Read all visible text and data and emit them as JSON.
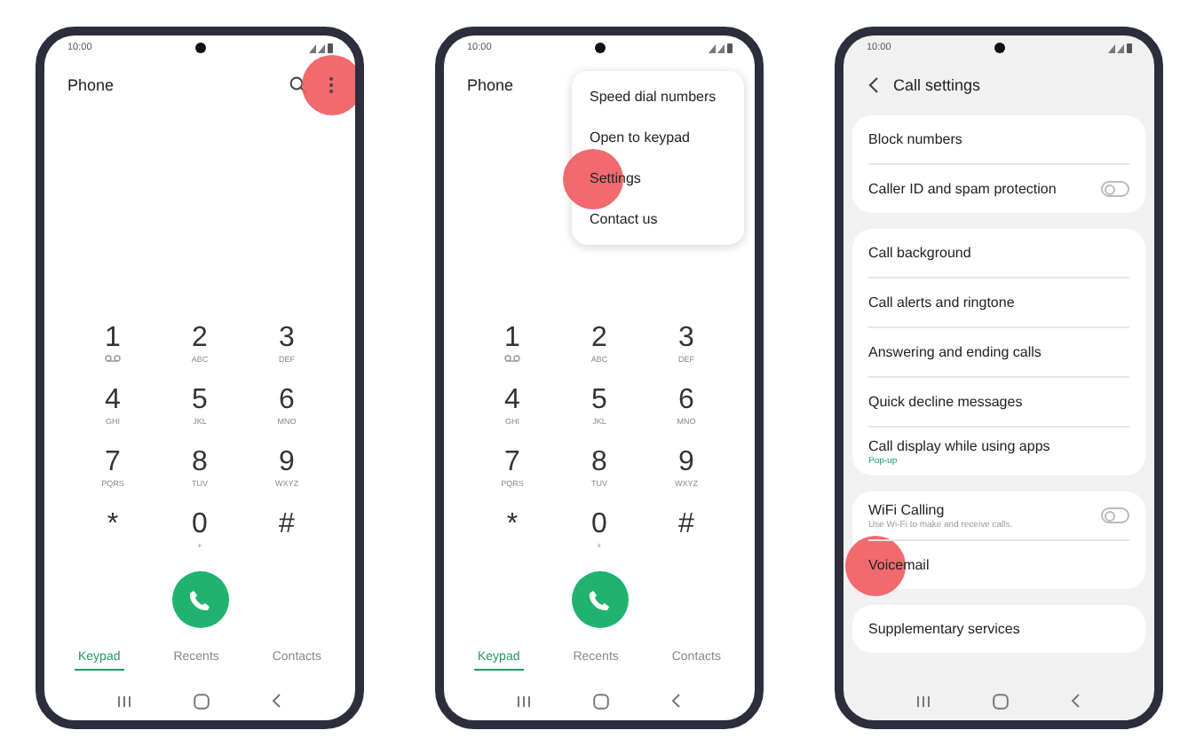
{
  "phones": [
    {
      "kind": "dialer",
      "status_time": "10:00",
      "title": "Phone",
      "menu_tapped": true,
      "keys": [
        {
          "digit": "1",
          "kind": "voicemail"
        },
        {
          "digit": "2",
          "kind": "letters",
          "letters": "ABC"
        },
        {
          "digit": "3",
          "kind": "letters",
          "letters": "DEF"
        },
        {
          "digit": "4",
          "kind": "letters",
          "letters": "GHI"
        },
        {
          "digit": "5",
          "kind": "letters",
          "letters": "JKL"
        },
        {
          "digit": "6",
          "kind": "letters",
          "letters": "MNO"
        },
        {
          "digit": "7",
          "kind": "letters",
          "letters": "PQRS"
        },
        {
          "digit": "8",
          "kind": "letters",
          "letters": "TUV"
        },
        {
          "digit": "9",
          "kind": "letters",
          "letters": "WXYZ"
        },
        {
          "digit": "*",
          "kind": "plain"
        },
        {
          "digit": "0",
          "kind": "letters",
          "letters": "+"
        },
        {
          "digit": "#",
          "kind": "plain"
        }
      ],
      "tabs": [
        {
          "label": "Keypad",
          "selected": true
        },
        {
          "label": "Recents",
          "selected": false
        },
        {
          "label": "Contacts",
          "selected": false
        }
      ]
    },
    {
      "kind": "dialer",
      "status_time": "10:00",
      "title": "Phone",
      "menu": [
        {
          "label": "Speed dial numbers",
          "tapped": false
        },
        {
          "label": "Open to keypad",
          "tapped": false
        },
        {
          "label": "Settings",
          "tapped": true
        },
        {
          "label": "Contact us",
          "tapped": false
        }
      ],
      "keys": [
        {
          "digit": "1",
          "kind": "voicemail"
        },
        {
          "digit": "2",
          "kind": "letters",
          "letters": "ABC"
        },
        {
          "digit": "3",
          "kind": "letters",
          "letters": "DEF"
        },
        {
          "digit": "4",
          "kind": "letters",
          "letters": "GHI"
        },
        {
          "digit": "5",
          "kind": "letters",
          "letters": "JKL"
        },
        {
          "digit": "6",
          "kind": "letters",
          "letters": "MNO"
        },
        {
          "digit": "7",
          "kind": "letters",
          "letters": "PQRS"
        },
        {
          "digit": "8",
          "kind": "letters",
          "letters": "TUV"
        },
        {
          "digit": "9",
          "kind": "letters",
          "letters": "WXYZ"
        },
        {
          "digit": "*",
          "kind": "plain"
        },
        {
          "digit": "0",
          "kind": "letters",
          "letters": "+"
        },
        {
          "digit": "#",
          "kind": "plain"
        }
      ],
      "tabs": [
        {
          "label": "Keypad",
          "selected": true
        },
        {
          "label": "Recents",
          "selected": false
        },
        {
          "label": "Contacts",
          "selected": false
        }
      ]
    },
    {
      "kind": "settings",
      "status_time": "10:00",
      "title": "Call settings",
      "groups": [
        {
          "items": [
            {
              "label": "Block numbers",
              "kind": "link",
              "tapped": false
            },
            {
              "label": "Caller ID and spam protection",
              "kind": "toggle",
              "on": false,
              "tapped": false
            }
          ]
        },
        {
          "items": [
            {
              "label": "Call background",
              "kind": "link",
              "tapped": false
            },
            {
              "label": "Call alerts and ringtone",
              "kind": "link",
              "tapped": false
            },
            {
              "label": "Answering and ending calls",
              "kind": "link",
              "tapped": false
            },
            {
              "label": "Quick decline messages",
              "kind": "link",
              "tapped": false
            },
            {
              "label": "Call display while using apps",
              "kind": "link",
              "value": "Pop-up",
              "tapped": false
            }
          ]
        },
        {
          "items": [
            {
              "label": "WiFi Calling",
              "kind": "toggle",
              "on": false,
              "description": "Use Wi-Fi to make and receive calls.",
              "tapped": false
            },
            {
              "label": "Voicemail",
              "kind": "link",
              "tapped": true
            }
          ]
        },
        {
          "items": [
            {
              "label": "Supplementary services",
              "kind": "link",
              "tapped": false
            }
          ]
        }
      ]
    }
  ]
}
